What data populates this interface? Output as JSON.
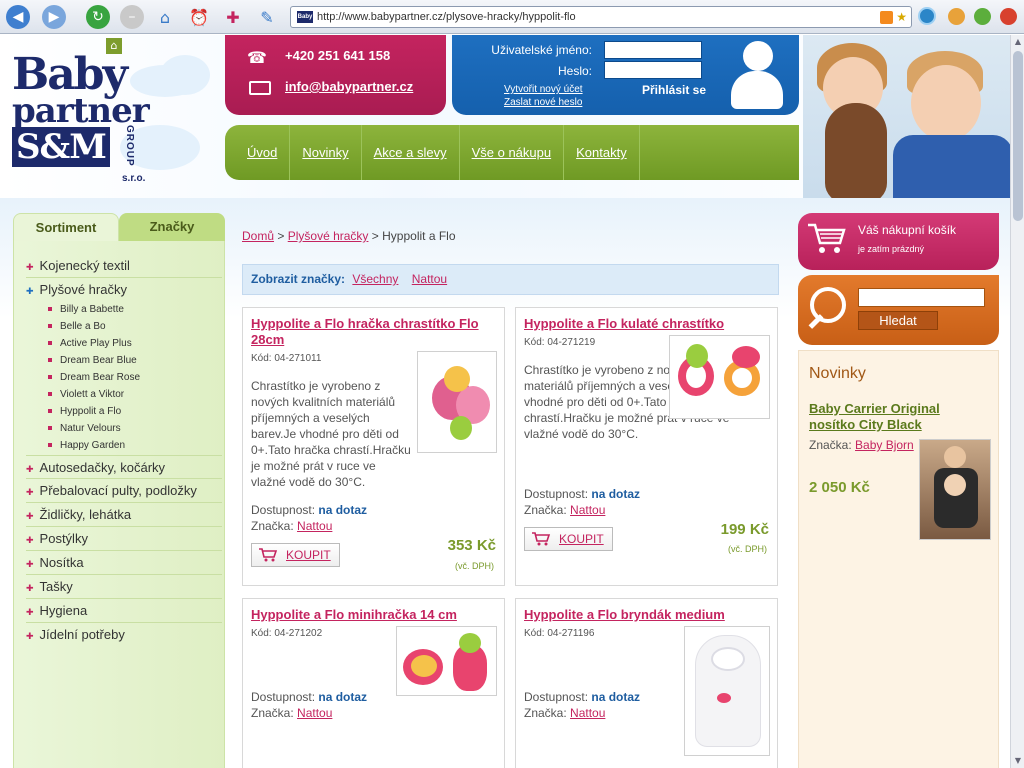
{
  "browser": {
    "url": "http://www.babypartner.cz/plysove-hracky/hyppolit-flo",
    "favicon_text": "Baby",
    "buttons": [
      "back-icon",
      "forward-icon",
      "reload-icon",
      "stop-icon",
      "home-icon",
      "history-icon",
      "new-tab-icon",
      "notes-icon"
    ]
  },
  "header": {
    "logo_line1": "Baby",
    "logo_line2": "partner",
    "logo_line3": "S&M",
    "logo_group": "GROUP",
    "logo_sro": "s.r.o.",
    "phone": "+420 251 641 158",
    "email": "info@babypartner.cz",
    "login": {
      "username_label": "Uživatelské jméno:",
      "password_label": "Heslo:",
      "create_account": "Vytvořit nový účet",
      "send_password": "Zaslat nové heslo",
      "submit": "Přihlásit se"
    },
    "nav": [
      "Úvod",
      "Novinky",
      "Akce a slevy",
      "Vše o nákupu",
      "Kontakty"
    ]
  },
  "sidebar": {
    "tabs": [
      "Sortiment",
      "Značky"
    ],
    "categories": [
      {
        "label": "Kojenecký textil"
      },
      {
        "label": "Plyšové hračky"
      },
      {
        "label": "Autosedačky, kočárky"
      },
      {
        "label": "Přebalovací pulty, podložky"
      },
      {
        "label": "Židličky, lehátka"
      },
      {
        "label": "Postýlky"
      },
      {
        "label": "Nosítka"
      },
      {
        "label": "Tašky"
      },
      {
        "label": "Hygiena"
      },
      {
        "label": "Jídelní potřeby"
      }
    ],
    "subcategories": [
      "Billy a Babette",
      "Belle a Bo",
      "Active Play Plus",
      "Dream Bear Blue",
      "Dream Bear Rose",
      "Violett a Viktor",
      "Hyppolit a Flo",
      "Natur Velours",
      "Happy Garden"
    ]
  },
  "breadcrumb": {
    "home": "Domů",
    "sep": ">",
    "category": "Plyšové hračky",
    "current": "Hyppolit a Flo"
  },
  "brand_filter": {
    "label": "Zobrazit značky:",
    "options": [
      "Všechny",
      "Nattou"
    ]
  },
  "products": [
    {
      "title": "Hyppolite a Flo hračka chrastítko Flo 28cm",
      "code": "Kód: 04-271011",
      "desc": "Chrastítko je vyrobeno z nových kvalitních materiálů příjemných a veselých barev.Je vhodné pro děti od 0+.Tato hračka chrastí.Hračku je možné prát v ruce ve vlažné vodě do 30°C.",
      "avail_label": "Dostupnost:",
      "avail": "na dotaz",
      "brand_label": "Značka:",
      "brand": "Nattou",
      "buy": "KOUPIT",
      "price": "353 Kč",
      "vat": "(vč. DPH)"
    },
    {
      "title": "Hyppolite a Flo kulaté chrastítko",
      "code": "Kód: 04-271219",
      "desc": "Chrastítko je vyrobeno z nových kvalitních materiálů příjemných a veselých barev.Je vhodné pro děti od 0+.Tato hračka chrastí.Hračku je možné prát v ruce ve vlažné vodě do 30°C.",
      "avail_label": "Dostupnost:",
      "avail": "na dotaz",
      "brand_label": "Značka:",
      "brand": "Nattou",
      "buy": "KOUPIT",
      "price": "199 Kč",
      "vat": "(vč. DPH)"
    },
    {
      "title": "Hyppolite a Flo minihračka 14 cm",
      "code": "Kód: 04-271202",
      "avail_label": "Dostupnost:",
      "avail": "na dotaz",
      "brand_label": "Značka:",
      "brand": "Nattou"
    },
    {
      "title": "Hyppolite a Flo bryndák medium",
      "code": "Kód: 04-271196",
      "avail_label": "Dostupnost:",
      "avail": "na dotaz",
      "brand_label": "Značka:",
      "brand": "Nattou"
    }
  ],
  "cart": {
    "title": "Váš nákupní košík",
    "status": "je zatím prázdný"
  },
  "search": {
    "button": "Hledat"
  },
  "news": {
    "title": "Novinky",
    "item_title": "Baby Carrier Original nosítko City Black",
    "brand_label": "Značka:",
    "brand": "Baby Bjorn",
    "price": "2 050 Kč"
  },
  "colors": {
    "magenta": "#c4245f",
    "blue": "#1e6fc0",
    "green": "#7a9a2c",
    "orange": "#d96a20",
    "navy": "#1d2a6b"
  }
}
